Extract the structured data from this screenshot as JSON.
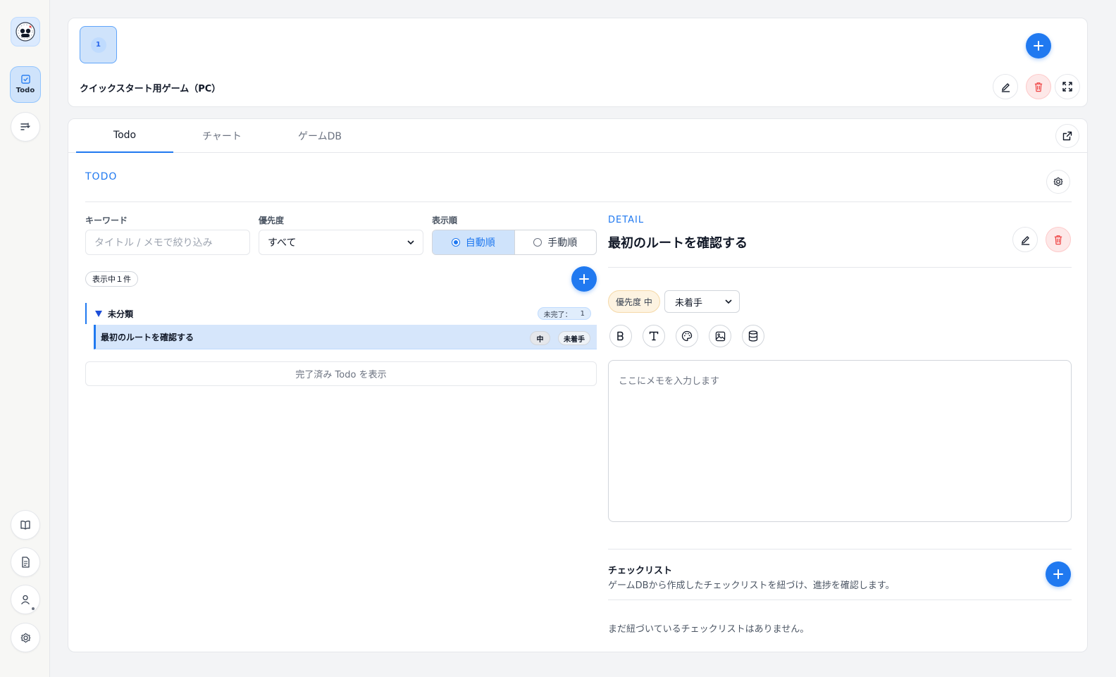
{
  "colors": {
    "accent": "#2079f0",
    "danger": "#ef4444",
    "selected_bg": "#cfe3fb"
  },
  "sidebar": {
    "logo_icon": "game-avatar-logo",
    "todo_label": "Todo",
    "items": [
      {
        "name": "filter-list-icon"
      },
      {
        "name": "book-icon"
      },
      {
        "name": "document-icon"
      },
      {
        "name": "user-icon"
      },
      {
        "name": "gear-icon"
      }
    ]
  },
  "game": {
    "tile_number": "1",
    "title": "クイックスタート用ゲーム（PC）"
  },
  "tabs": [
    {
      "label": "Todo",
      "active": true
    },
    {
      "label": "チャート",
      "active": false
    },
    {
      "label": "ゲームDB",
      "active": false
    }
  ],
  "todo": {
    "section_label": "TODO",
    "filters": {
      "keyword_label": "キーワード",
      "keyword_placeholder": "タイトル / メモで絞り込み",
      "priority_label": "優先度",
      "priority_value": "すべて",
      "order_label": "表示順",
      "order_options": [
        "自動順",
        "手動順"
      ],
      "order_selected": "自動順"
    },
    "showing_count": "表示中１件",
    "group": {
      "name": "未分類",
      "incomplete_label": "未完了：",
      "incomplete_count": "1"
    },
    "items": [
      {
        "title": "最初のルートを確認する",
        "priority": "中",
        "status": "未着手"
      }
    ],
    "show_completed": "完了済み Todo を表示"
  },
  "detail": {
    "section_label": "DETAIL",
    "title": "最初のルートを確認する",
    "priority_chip": "優先度 中",
    "status_value": "未着手",
    "toolbar": [
      "bold-icon",
      "text-icon",
      "palette-icon",
      "image-icon",
      "database-icon"
    ],
    "memo_placeholder": "ここにメモを入力します",
    "checklist": {
      "title": "チェックリスト",
      "description": "ゲームDBから作成したチェックリストを紐づけ、進捗を確認します。",
      "empty": "まだ紐づいているチェックリストはありません。"
    }
  }
}
